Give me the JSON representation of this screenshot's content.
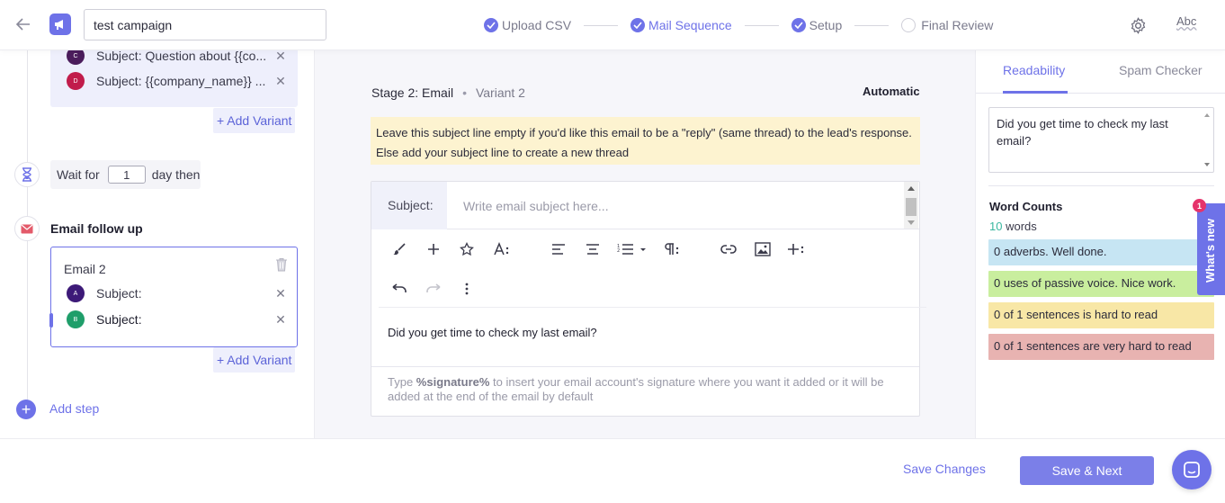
{
  "header": {
    "campaign_name": "test campaign",
    "steps": [
      {
        "label": "Upload CSV",
        "state": "done"
      },
      {
        "label": "Mail Sequence",
        "state": "active"
      },
      {
        "label": "Setup",
        "state": "done"
      },
      {
        "label": "Final Review",
        "state": "pending"
      }
    ],
    "spell_label": "Abc"
  },
  "sequence": {
    "top_variants": [
      {
        "avatar": "C",
        "subject": "Subject: Question about {{co...",
        "color": "#4b1d5c"
      },
      {
        "avatar": "D",
        "subject": "Subject: {{company_name}} ...",
        "color": "#c11c4b"
      }
    ],
    "add_variant_label": "+ Add Variant",
    "wait": {
      "prefix": "Wait for",
      "value": "1",
      "suffix": "day then"
    },
    "followup_title": "Email follow up",
    "email_card": {
      "title": "Email 2",
      "variants": [
        {
          "avatar": "A",
          "subject": "Subject:",
          "color": "#3d1a78"
        },
        {
          "avatar": "B",
          "subject": "Subject:",
          "color": "#1f9e6a"
        }
      ]
    },
    "add_step_label": "Add step"
  },
  "editor": {
    "stage_title": "Stage 2: Email",
    "stage_sep": "•",
    "variant_label": "Variant 2",
    "mode": "Automatic",
    "notice_line1": "Leave this subject line empty if you'd like this email to be a \"reply\" (same thread) to the lead's response.",
    "notice_line2": "Else add your subject line to create a new thread",
    "subject_label": "Subject:",
    "subject_placeholder": "Write email subject here...",
    "body": "Did you get time to check my last email?",
    "sig_pre": "Type ",
    "sig_token": "%signature%",
    "sig_post": " to insert your email account's signature where you want it added or it will be added at the end of the email by default"
  },
  "right": {
    "tabs": [
      {
        "label": "Readability",
        "active": true
      },
      {
        "label": "Spam Checker",
        "active": false
      }
    ],
    "preview_text": "Did you get time to check my last email?",
    "word_counts_title": "Word Counts",
    "word_count_num": "10",
    "word_count_unit": " words",
    "pills": [
      {
        "text": "0 adverbs. Well done.",
        "color": "#c6e5f3"
      },
      {
        "text": "0 uses of passive voice. Nice work.",
        "color": "#c9ee9e"
      },
      {
        "text": "0 of 1 sentences is hard to read",
        "color": "#f8e7a6"
      },
      {
        "text": "0 of 1 sentences are very hard to read",
        "color": "#e8b3b1"
      }
    ],
    "whats_new": "What's new",
    "badge": "1"
  },
  "footer": {
    "save_changes": "Save Changes",
    "save_next": "Save & Next"
  },
  "colors": {
    "accent": "#6e72e8",
    "notice_bg": "#fdf3d0"
  }
}
